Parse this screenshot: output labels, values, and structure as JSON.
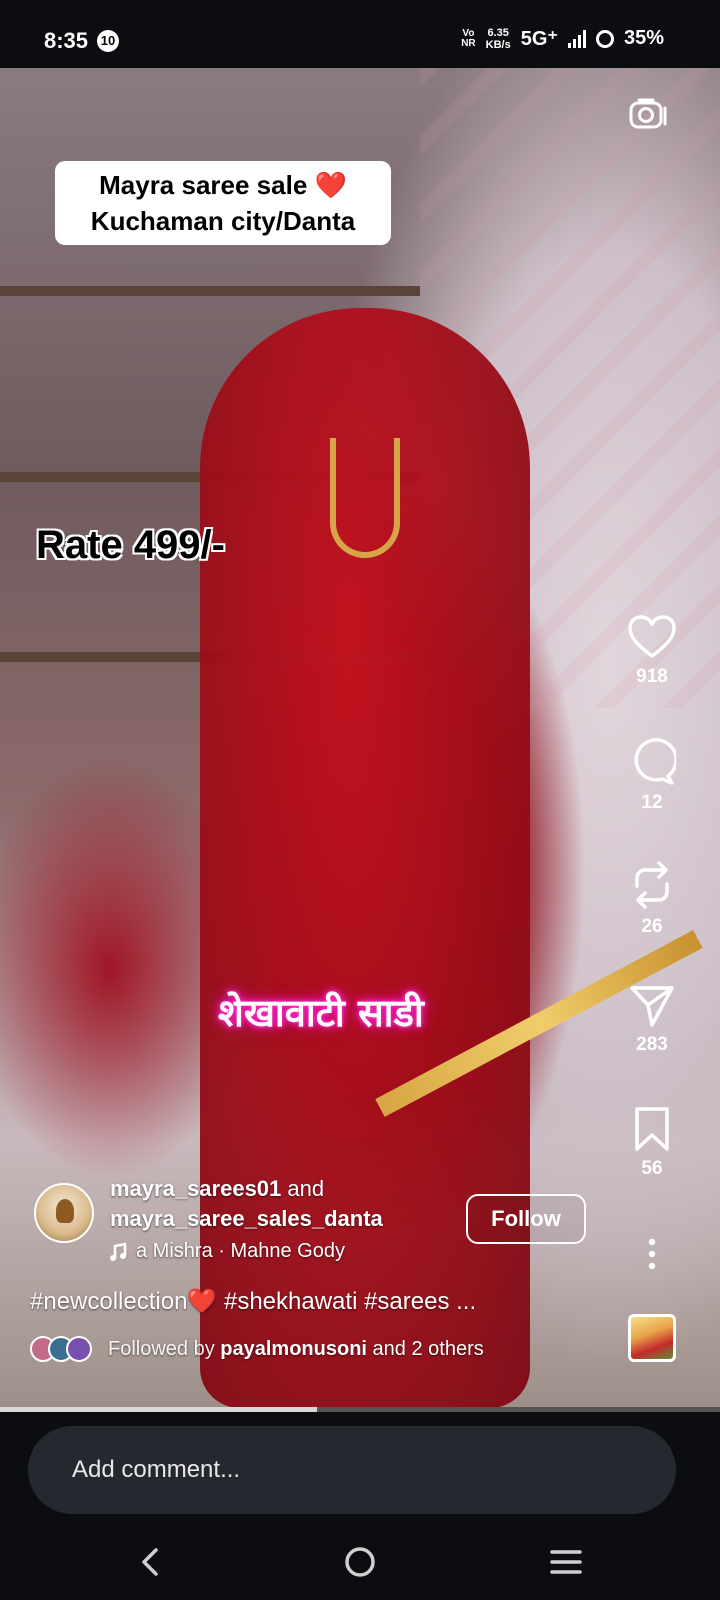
{
  "status_bar": {
    "time": "8:35",
    "notification_count": "10",
    "volte_top": "Vo",
    "volte_bottom": "NR",
    "speed_value": "6.35",
    "speed_unit": "KB/s",
    "network": "5G⁺",
    "battery": "35%"
  },
  "reel": {
    "caption_line1": "Mayra saree sale ❤️",
    "caption_line2": "Kuchaman city/Danta",
    "rate_text": "Rate 499/-",
    "overlay_hindi": "शेखावाटी साडी"
  },
  "actions": {
    "likes": "918",
    "comments": "12",
    "reposts": "26",
    "shares": "283",
    "saves": "56"
  },
  "post": {
    "user1": "mayra_sarees01",
    "conjunction": " and",
    "user2": "mayra_saree_sales_danta",
    "follow_label": "Follow",
    "audio": "a Mishra · Mahne Gody",
    "hashtags": "#newcollection❤️ #shekhawati #sarees ...",
    "followed_by_prefix": "Followed by ",
    "followed_by_user": "payalmonusoni",
    "followed_by_suffix": " and 2 others"
  },
  "progress_fraction": 0.44,
  "comment": {
    "placeholder": "Add comment..."
  },
  "icons": {
    "camera": "camera-icon",
    "like": "heart-icon",
    "comment": "comment-bubble-icon",
    "repost": "repost-icon",
    "share": "send-icon",
    "save": "bookmark-icon",
    "more": "more-vertical-icon",
    "music": "music-note-icon",
    "back": "back-icon",
    "home": "home-icon",
    "recents": "recents-icon"
  },
  "colors": {
    "follow_border": "#ffffff",
    "hindi_glow": "#ff00c8",
    "comment_box": "#25292f",
    "bar_bg": "#0b0d10"
  }
}
